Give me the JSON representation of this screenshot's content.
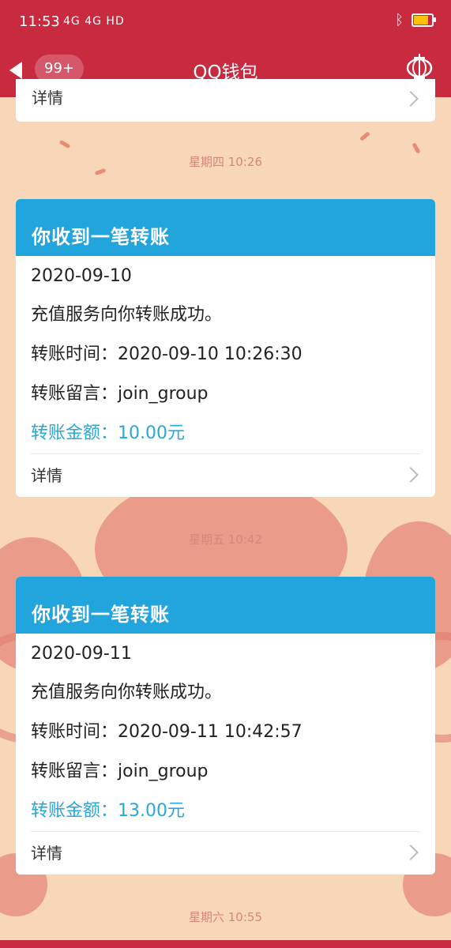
{
  "status": {
    "time": "11:53",
    "network": "4G 4G HD",
    "battery_level": 0.8
  },
  "header": {
    "back_icon": "back-arrow-icon",
    "badge": "99+",
    "title": "QQ钱包",
    "right_icon": "lantern-icon"
  },
  "messages": {
    "top_card_link": "详情",
    "time1": "星期四 10:26",
    "card1": {
      "title": "你收到一笔转账",
      "date": "2020-09-10",
      "line1": "充值服务向你转账成功。",
      "time": "转账时间：2020-09-10 10:26:30",
      "note": "转账留言：join_group",
      "amount": "转账金额：10.00元",
      "details": "详情"
    },
    "time2": "星期五 10:42",
    "card2": {
      "title": "你收到一笔转账",
      "date": "2020-09-11",
      "line1": "充值服务向你转账成功。",
      "time": "转账时间：2020-09-11 10:42:57",
      "note": "转账留言：join_group",
      "amount": "转账金额：13.00元",
      "details": "详情"
    },
    "time3": "星期六 10:55"
  },
  "colors": {
    "header_red": "#c82a3f",
    "card_header_blue": "#22a4dc",
    "amount_blue": "#27a8d6",
    "background_peach": "#f8d6b8"
  }
}
